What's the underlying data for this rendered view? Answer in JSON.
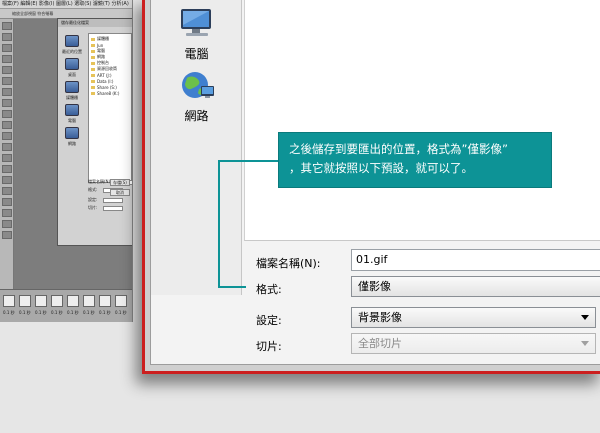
{
  "ps_thumbnail": {
    "menu_text": "檔案(F) 編輯(E) 影像(I) 圖層(L) 選取(S) 濾鏡(T) 分析(A)",
    "options_text": "縮放全部視窗 符合螢幕",
    "dialog_title": "儲存最佳化檔案",
    "sidebar": [
      "最近的位置",
      "桌面",
      "媒體櫃",
      "電腦",
      "網路"
    ],
    "files": [
      "媒體櫃",
      "Jun",
      "電腦",
      "網路",
      "控制台",
      "資源回收筒",
      "ART (J:)",
      "Data (I:)",
      "Share (S:)",
      "Share8 (K:)"
    ],
    "form_labels": [
      "檔案名稱(N):",
      "格式:",
      "設定:",
      "切片:"
    ],
    "buttons": [
      "存檔(S)",
      "取消"
    ],
    "frame_labels": [
      "0.1 秒",
      "0.1 秒",
      "0.1 秒",
      "0.1 秒",
      "0.1 秒",
      "0.1 秒",
      "0.1 秒",
      "0.1 秒"
    ]
  },
  "sidebar": {
    "computer_label": "電腦",
    "network_label": "網路"
  },
  "form": {
    "filename_label": "檔案名稱(N):",
    "filename_value": "01.gif",
    "format_label": "格式:",
    "format_value": "僅影像",
    "settings_label": "設定:",
    "settings_value": "背景影像",
    "slices_label": "切片:",
    "slices_value": "全部切片"
  },
  "callout": {
    "line1": "之後儲存到要匯出的位置，格式為”僅影像”",
    "line2": "，其它就按照以下預設，就可以了。"
  },
  "colors": {
    "frame_red": "#cc1f1f",
    "callout_teal": "#0d9396"
  }
}
